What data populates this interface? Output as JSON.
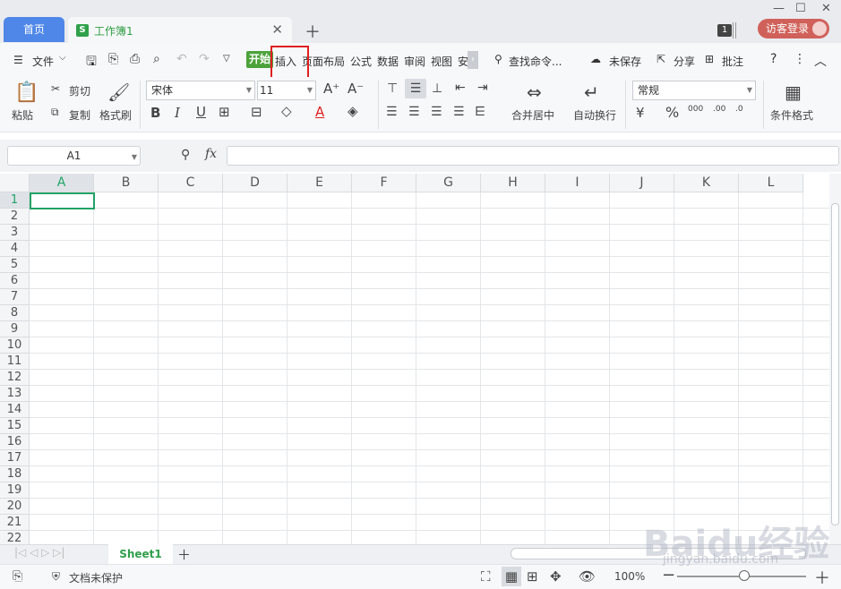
{
  "tabs": {
    "home": "首页",
    "workbook": "工作簿1"
  },
  "titlebar": {
    "notif_count": "1",
    "login": "访客登录"
  },
  "menu": {
    "file": "文件",
    "start": "开始",
    "insert": "插入",
    "page_layout": "页面布局",
    "formula": "公式",
    "data": "数据",
    "review": "审阅",
    "view": "视图",
    "more": "安",
    "search": "查找命令...",
    "unsaved": "未保存",
    "share": "分享",
    "comment": "批注"
  },
  "ribbon": {
    "paste": "粘贴",
    "cut": "剪切",
    "copy": "复制",
    "format_painter": "格式刷",
    "font": "宋体",
    "font_size": "11",
    "merge_center": "合并居中",
    "wrap_text": "自动换行",
    "number_format": "常规",
    "cond_format": "条件格式"
  },
  "formula_bar": {
    "cell_ref": "A1",
    "fx": "fx",
    "value": ""
  },
  "grid": {
    "columns": [
      "A",
      "B",
      "C",
      "D",
      "E",
      "F",
      "G",
      "H",
      "I",
      "J",
      "K",
      "L"
    ],
    "rows": [
      "1",
      "2",
      "3",
      "4",
      "5",
      "6",
      "7",
      "8",
      "9",
      "10",
      "11",
      "12",
      "13",
      "14",
      "15",
      "16",
      "17",
      "18",
      "19",
      "20",
      "21",
      "22"
    ]
  },
  "sheets": {
    "active": "Sheet1"
  },
  "status": {
    "protect": "文档未保护",
    "zoom": "100%"
  },
  "watermark": {
    "brand": "Baidu经验",
    "url": "jingyan.baidu.com"
  }
}
